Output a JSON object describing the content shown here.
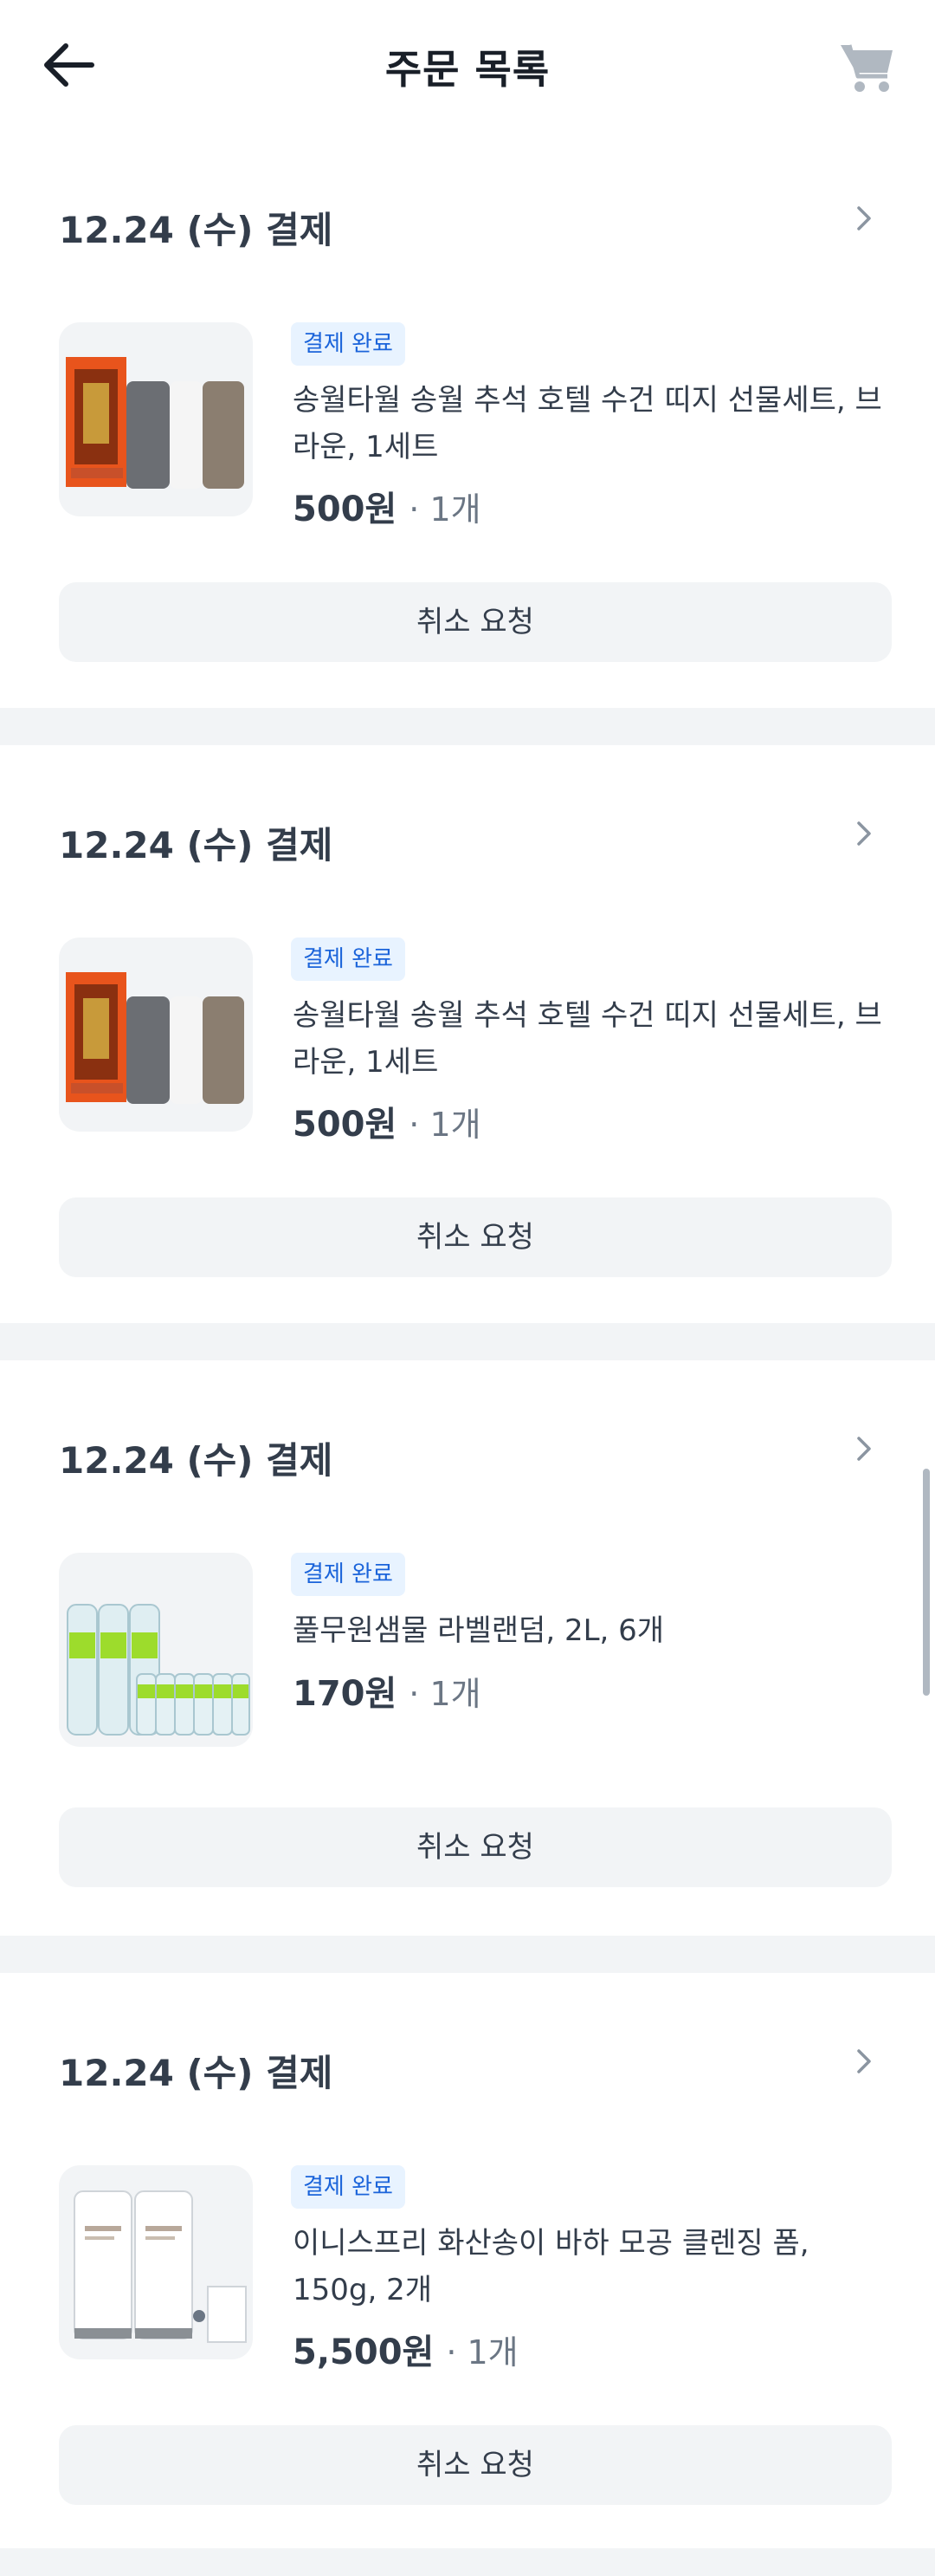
{
  "header": {
    "title": "주문 목록",
    "back_icon": "arrow-left-icon",
    "cart_icon": "cart-icon"
  },
  "orders": [
    {
      "date": "12.24 (수) 결제",
      "status": "결제 완료",
      "product_name": "송월타월 송월 추석 호텔 수건 띠지 선물세트, 브라운, 1세트",
      "price": "500원",
      "quantity": "· 1개",
      "cancel_label": "취소 요청"
    },
    {
      "date": "12.24 (수) 결제",
      "status": "결제 완료",
      "product_name": "송월타월 송월 추석 호텔 수건 띠지 선물세트, 브라운, 1세트",
      "price": "500원",
      "quantity": "· 1개",
      "cancel_label": "취소 요청"
    },
    {
      "date": "12.24 (수) 결제",
      "status": "결제 완료",
      "product_name": "풀무원샘물 라벨랜덤, 2L, 6개",
      "price": "170원",
      "quantity": "· 1개",
      "cancel_label": "취소 요청"
    },
    {
      "date": "12.24 (수) 결제",
      "status": "결제 완료",
      "product_name": "이니스프리 화산송이 바하 모공 클렌징 폼, 150g, 2개",
      "price": "5,500원",
      "quantity": "· 1개",
      "cancel_label": "취소 요청"
    }
  ],
  "colors": {
    "badge_bg": "#e8f3ff",
    "badge_text": "#1b64da",
    "divider": "#f2f4f6",
    "button_bg": "#f2f4f6"
  }
}
